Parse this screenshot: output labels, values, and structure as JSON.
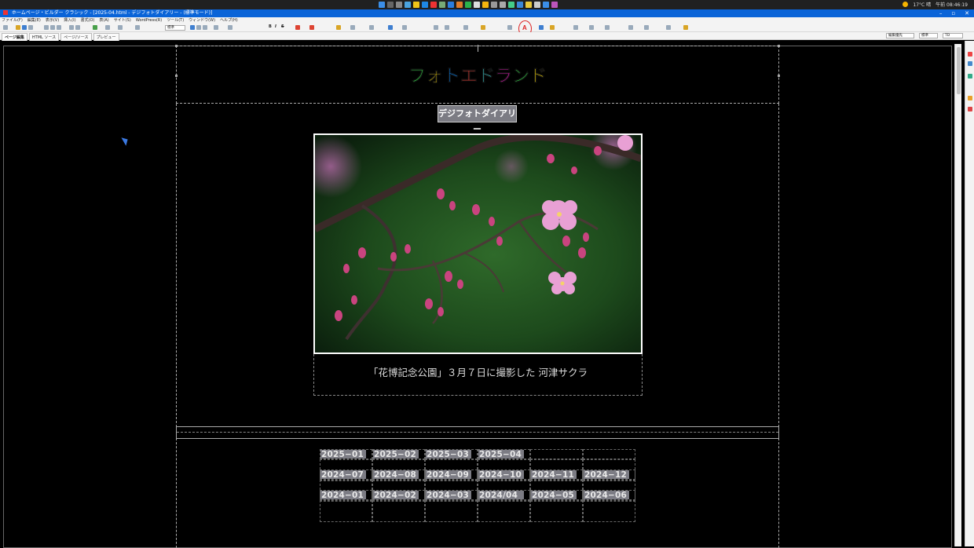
{
  "window": {
    "title": "ホームページ・ビルダー クラシック - [2025-04.html - デジフォトダイアリー - (標準モード)]"
  },
  "menu": {
    "items": [
      "ファイル(F)",
      "編集(E)",
      "表示(V)",
      "挿入(I)",
      "書式(O)",
      "表(A)",
      "サイト(S)",
      "WordPress(R)",
      "ツール(T)",
      "ウィンドウ(W)",
      "ヘルプ(H)"
    ]
  },
  "toolbar": {
    "style_select": "標準",
    "highlight_letter": "A",
    "right_select_1": "編集優先",
    "right_select_2": "標準",
    "right_select_3": "TD"
  },
  "view_tabs": {
    "tabs": [
      "ページ編集",
      "HTML ソース",
      "ページ/ソース",
      "プレビュー"
    ]
  },
  "tray": {
    "weather": "17°C 晴",
    "clock": "午前 08:46:19"
  },
  "page": {
    "site_title_chars": [
      {
        "ch": "フ",
        "color": "#2ecc40"
      },
      {
        "ch": "ォ",
        "color": "#ffdc00"
      },
      {
        "ch": "ト",
        "color": "#0074d9"
      },
      {
        "ch": "エ",
        "color": "#ff4136"
      },
      {
        "ch": "ド",
        "color": "#39cccc"
      },
      {
        "ch": "ラ",
        "color": "#f012be"
      },
      {
        "ch": "ン",
        "color": "#2ecc40"
      },
      {
        "ch": "ド",
        "color": "#ffdc00"
      }
    ],
    "subtitle": "デジフォトダイアリー",
    "caption": "「花博記念公園」３月７日に撮影した 河津サクラ"
  },
  "archive": {
    "rows": [
      [
        "2025−01",
        "2025−02",
        "2025−03",
        "2025−04",
        "",
        ""
      ],
      [
        "2024−07",
        "2024−08",
        "2024−09",
        "2024−10",
        "2024−11",
        "2024−12"
      ],
      [
        "2024−01",
        "2024−02",
        "2024−03",
        "2024/04",
        "2024−05",
        "2024−06"
      ]
    ]
  }
}
